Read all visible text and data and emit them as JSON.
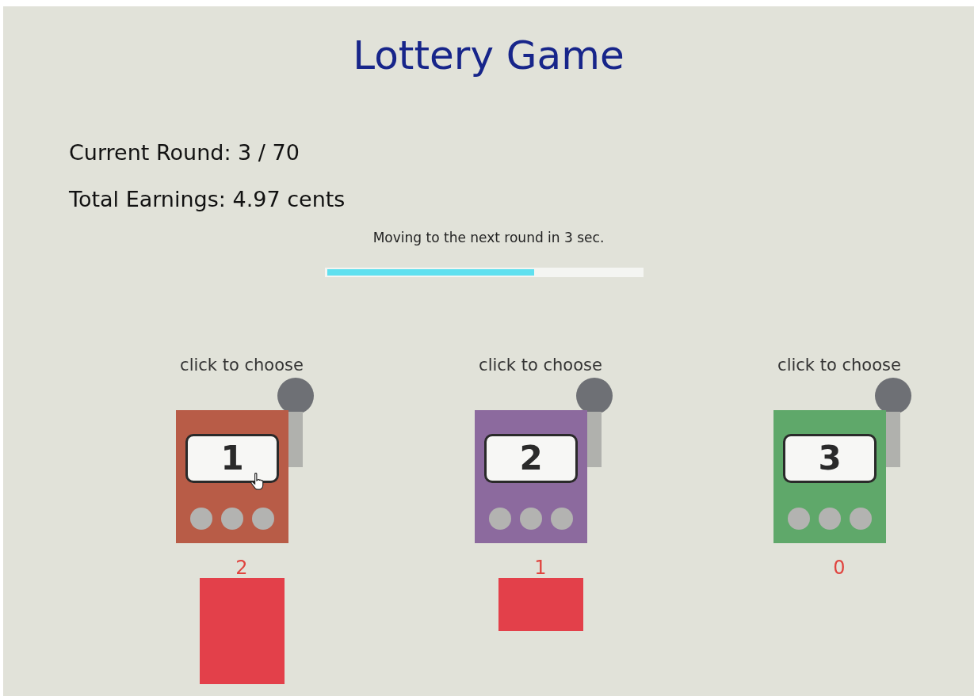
{
  "title": "Lottery Game",
  "current_round": "Current Round: 3 / 70",
  "total_earnings": "Total Earnings: 4.97 cents",
  "countdown": {
    "message": "Moving to the next round in 3 sec.",
    "level": 0.66
  },
  "machines": [
    {
      "prompt": "click to choose",
      "number": "1",
      "color": "#b85c47",
      "count": "2",
      "hovered": true
    },
    {
      "prompt": "click to choose",
      "number": "2",
      "color": "#8c6a9e",
      "count": "1",
      "hovered": false
    },
    {
      "prompt": "click to choose",
      "number": "3",
      "color": "#5fa86a",
      "count": "0",
      "hovered": false
    }
  ]
}
